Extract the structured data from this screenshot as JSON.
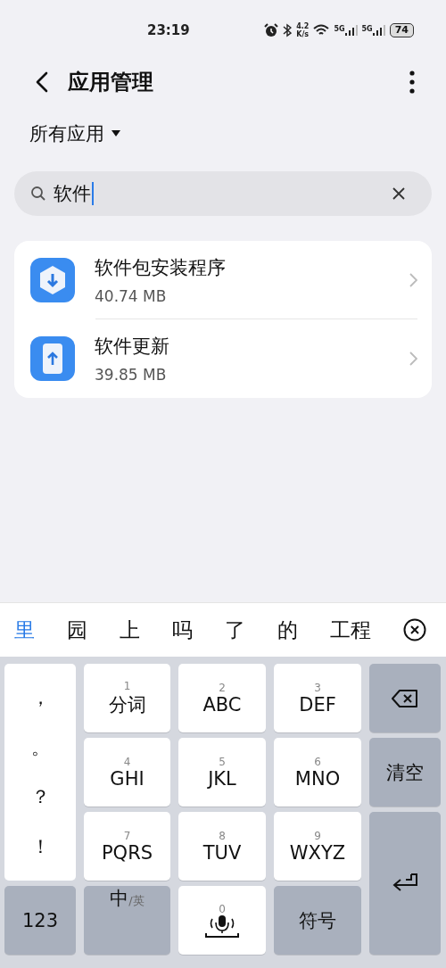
{
  "status_bar": {
    "time": "23:19",
    "speed_value": "4.2",
    "speed_unit": "K/s",
    "networks": [
      "5G",
      "5G"
    ],
    "battery": "74"
  },
  "header": {
    "title": "应用管理"
  },
  "filter": {
    "label": "所有应用"
  },
  "search": {
    "value": "软件"
  },
  "apps": [
    {
      "name": "软件包安装程序",
      "size": "40.74 MB",
      "kind": "installer"
    },
    {
      "name": "软件更新",
      "size": "39.85 MB",
      "kind": "update"
    }
  ],
  "candidates": [
    {
      "text": "里",
      "selected": true
    },
    {
      "text": "园",
      "selected": false
    },
    {
      "text": "上",
      "selected": false
    },
    {
      "text": "吗",
      "selected": false
    },
    {
      "text": "了",
      "selected": false
    },
    {
      "text": "的",
      "selected": false
    },
    {
      "text": "工程",
      "selected": false
    }
  ],
  "keyboard": {
    "punctuation": [
      "，",
      "。",
      "？",
      "！"
    ],
    "keys": [
      {
        "number": "1",
        "label": "分词"
      },
      {
        "number": "2",
        "label": "ABC"
      },
      {
        "number": "3",
        "label": "DEF"
      },
      {
        "number": "4",
        "label": "GHI"
      },
      {
        "number": "5",
        "label": "JKL"
      },
      {
        "number": "6",
        "label": "MNO"
      },
      {
        "number": "7",
        "label": "PQRS"
      },
      {
        "number": "8",
        "label": "TUV"
      },
      {
        "number": "9",
        "label": "WXYZ"
      }
    ],
    "clear": "清空",
    "numbers": "123",
    "lang_main": "中",
    "lang_alt": "/英",
    "space_number": "0",
    "symbols": "符号"
  }
}
